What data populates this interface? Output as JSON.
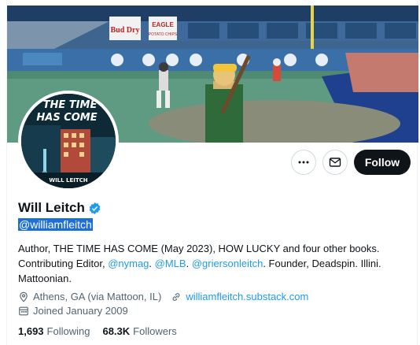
{
  "profile": {
    "name": "Will Leitch",
    "handle": "@williamfleitch",
    "bio_parts": {
      "p1": "Author, THE TIME HAS COME (May 2023), HOW LUCKY and four other books. Contributing Editor, ",
      "l1": "@nymag",
      "p2": ". ",
      "l2": "@MLB",
      "p3": ". ",
      "l3": "@griersonleitch",
      "p4": ". Founder, Deadspin. Illini. Mattoonian."
    },
    "location": "Athens, GA (via Mattoon, IL)",
    "website": "williamfleitch.substack.com",
    "joined": "Joined January 2009",
    "following_count": "1,693",
    "following_label": "Following",
    "followers_count": "68.3K",
    "followers_label": "Followers"
  },
  "actions": {
    "follow_label": "Follow",
    "more_icon": "more-icon",
    "message_icon": "envelope-icon"
  },
  "avatar_book": {
    "title_line1": "THE TIME",
    "title_line2": "HAS COME",
    "author": "WILL LEITCH"
  },
  "banner_signs": {
    "sign1": "Bud Dry",
    "sign2": "EAGLE",
    "sign3": "POTATO CHIPS"
  },
  "colors": {
    "accent": "#1d9bf0",
    "follow_bg": "#0f1419",
    "verified": "#1d9bf0",
    "muted_text": "#536471"
  }
}
